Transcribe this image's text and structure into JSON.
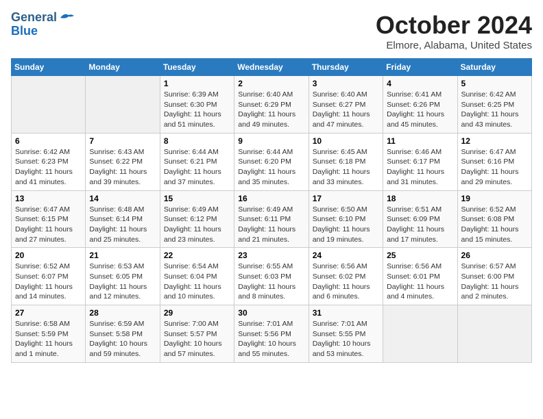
{
  "header": {
    "logo_line1": "General",
    "logo_line2": "Blue",
    "main_title": "October 2024",
    "subtitle": "Elmore, Alabama, United States"
  },
  "weekdays": [
    "Sunday",
    "Monday",
    "Tuesday",
    "Wednesday",
    "Thursday",
    "Friday",
    "Saturday"
  ],
  "weeks": [
    [
      {
        "num": "",
        "info": ""
      },
      {
        "num": "",
        "info": ""
      },
      {
        "num": "1",
        "info": "Sunrise: 6:39 AM\nSunset: 6:30 PM\nDaylight: 11 hours and 51 minutes."
      },
      {
        "num": "2",
        "info": "Sunrise: 6:40 AM\nSunset: 6:29 PM\nDaylight: 11 hours and 49 minutes."
      },
      {
        "num": "3",
        "info": "Sunrise: 6:40 AM\nSunset: 6:27 PM\nDaylight: 11 hours and 47 minutes."
      },
      {
        "num": "4",
        "info": "Sunrise: 6:41 AM\nSunset: 6:26 PM\nDaylight: 11 hours and 45 minutes."
      },
      {
        "num": "5",
        "info": "Sunrise: 6:42 AM\nSunset: 6:25 PM\nDaylight: 11 hours and 43 minutes."
      }
    ],
    [
      {
        "num": "6",
        "info": "Sunrise: 6:42 AM\nSunset: 6:23 PM\nDaylight: 11 hours and 41 minutes."
      },
      {
        "num": "7",
        "info": "Sunrise: 6:43 AM\nSunset: 6:22 PM\nDaylight: 11 hours and 39 minutes."
      },
      {
        "num": "8",
        "info": "Sunrise: 6:44 AM\nSunset: 6:21 PM\nDaylight: 11 hours and 37 minutes."
      },
      {
        "num": "9",
        "info": "Sunrise: 6:44 AM\nSunset: 6:20 PM\nDaylight: 11 hours and 35 minutes."
      },
      {
        "num": "10",
        "info": "Sunrise: 6:45 AM\nSunset: 6:18 PM\nDaylight: 11 hours and 33 minutes."
      },
      {
        "num": "11",
        "info": "Sunrise: 6:46 AM\nSunset: 6:17 PM\nDaylight: 11 hours and 31 minutes."
      },
      {
        "num": "12",
        "info": "Sunrise: 6:47 AM\nSunset: 6:16 PM\nDaylight: 11 hours and 29 minutes."
      }
    ],
    [
      {
        "num": "13",
        "info": "Sunrise: 6:47 AM\nSunset: 6:15 PM\nDaylight: 11 hours and 27 minutes."
      },
      {
        "num": "14",
        "info": "Sunrise: 6:48 AM\nSunset: 6:14 PM\nDaylight: 11 hours and 25 minutes."
      },
      {
        "num": "15",
        "info": "Sunrise: 6:49 AM\nSunset: 6:12 PM\nDaylight: 11 hours and 23 minutes."
      },
      {
        "num": "16",
        "info": "Sunrise: 6:49 AM\nSunset: 6:11 PM\nDaylight: 11 hours and 21 minutes."
      },
      {
        "num": "17",
        "info": "Sunrise: 6:50 AM\nSunset: 6:10 PM\nDaylight: 11 hours and 19 minutes."
      },
      {
        "num": "18",
        "info": "Sunrise: 6:51 AM\nSunset: 6:09 PM\nDaylight: 11 hours and 17 minutes."
      },
      {
        "num": "19",
        "info": "Sunrise: 6:52 AM\nSunset: 6:08 PM\nDaylight: 11 hours and 15 minutes."
      }
    ],
    [
      {
        "num": "20",
        "info": "Sunrise: 6:52 AM\nSunset: 6:07 PM\nDaylight: 11 hours and 14 minutes."
      },
      {
        "num": "21",
        "info": "Sunrise: 6:53 AM\nSunset: 6:05 PM\nDaylight: 11 hours and 12 minutes."
      },
      {
        "num": "22",
        "info": "Sunrise: 6:54 AM\nSunset: 6:04 PM\nDaylight: 11 hours and 10 minutes."
      },
      {
        "num": "23",
        "info": "Sunrise: 6:55 AM\nSunset: 6:03 PM\nDaylight: 11 hours and 8 minutes."
      },
      {
        "num": "24",
        "info": "Sunrise: 6:56 AM\nSunset: 6:02 PM\nDaylight: 11 hours and 6 minutes."
      },
      {
        "num": "25",
        "info": "Sunrise: 6:56 AM\nSunset: 6:01 PM\nDaylight: 11 hours and 4 minutes."
      },
      {
        "num": "26",
        "info": "Sunrise: 6:57 AM\nSunset: 6:00 PM\nDaylight: 11 hours and 2 minutes."
      }
    ],
    [
      {
        "num": "27",
        "info": "Sunrise: 6:58 AM\nSunset: 5:59 PM\nDaylight: 11 hours and 1 minute."
      },
      {
        "num": "28",
        "info": "Sunrise: 6:59 AM\nSunset: 5:58 PM\nDaylight: 10 hours and 59 minutes."
      },
      {
        "num": "29",
        "info": "Sunrise: 7:00 AM\nSunset: 5:57 PM\nDaylight: 10 hours and 57 minutes."
      },
      {
        "num": "30",
        "info": "Sunrise: 7:01 AM\nSunset: 5:56 PM\nDaylight: 10 hours and 55 minutes."
      },
      {
        "num": "31",
        "info": "Sunrise: 7:01 AM\nSunset: 5:55 PM\nDaylight: 10 hours and 53 minutes."
      },
      {
        "num": "",
        "info": ""
      },
      {
        "num": "",
        "info": ""
      }
    ]
  ]
}
